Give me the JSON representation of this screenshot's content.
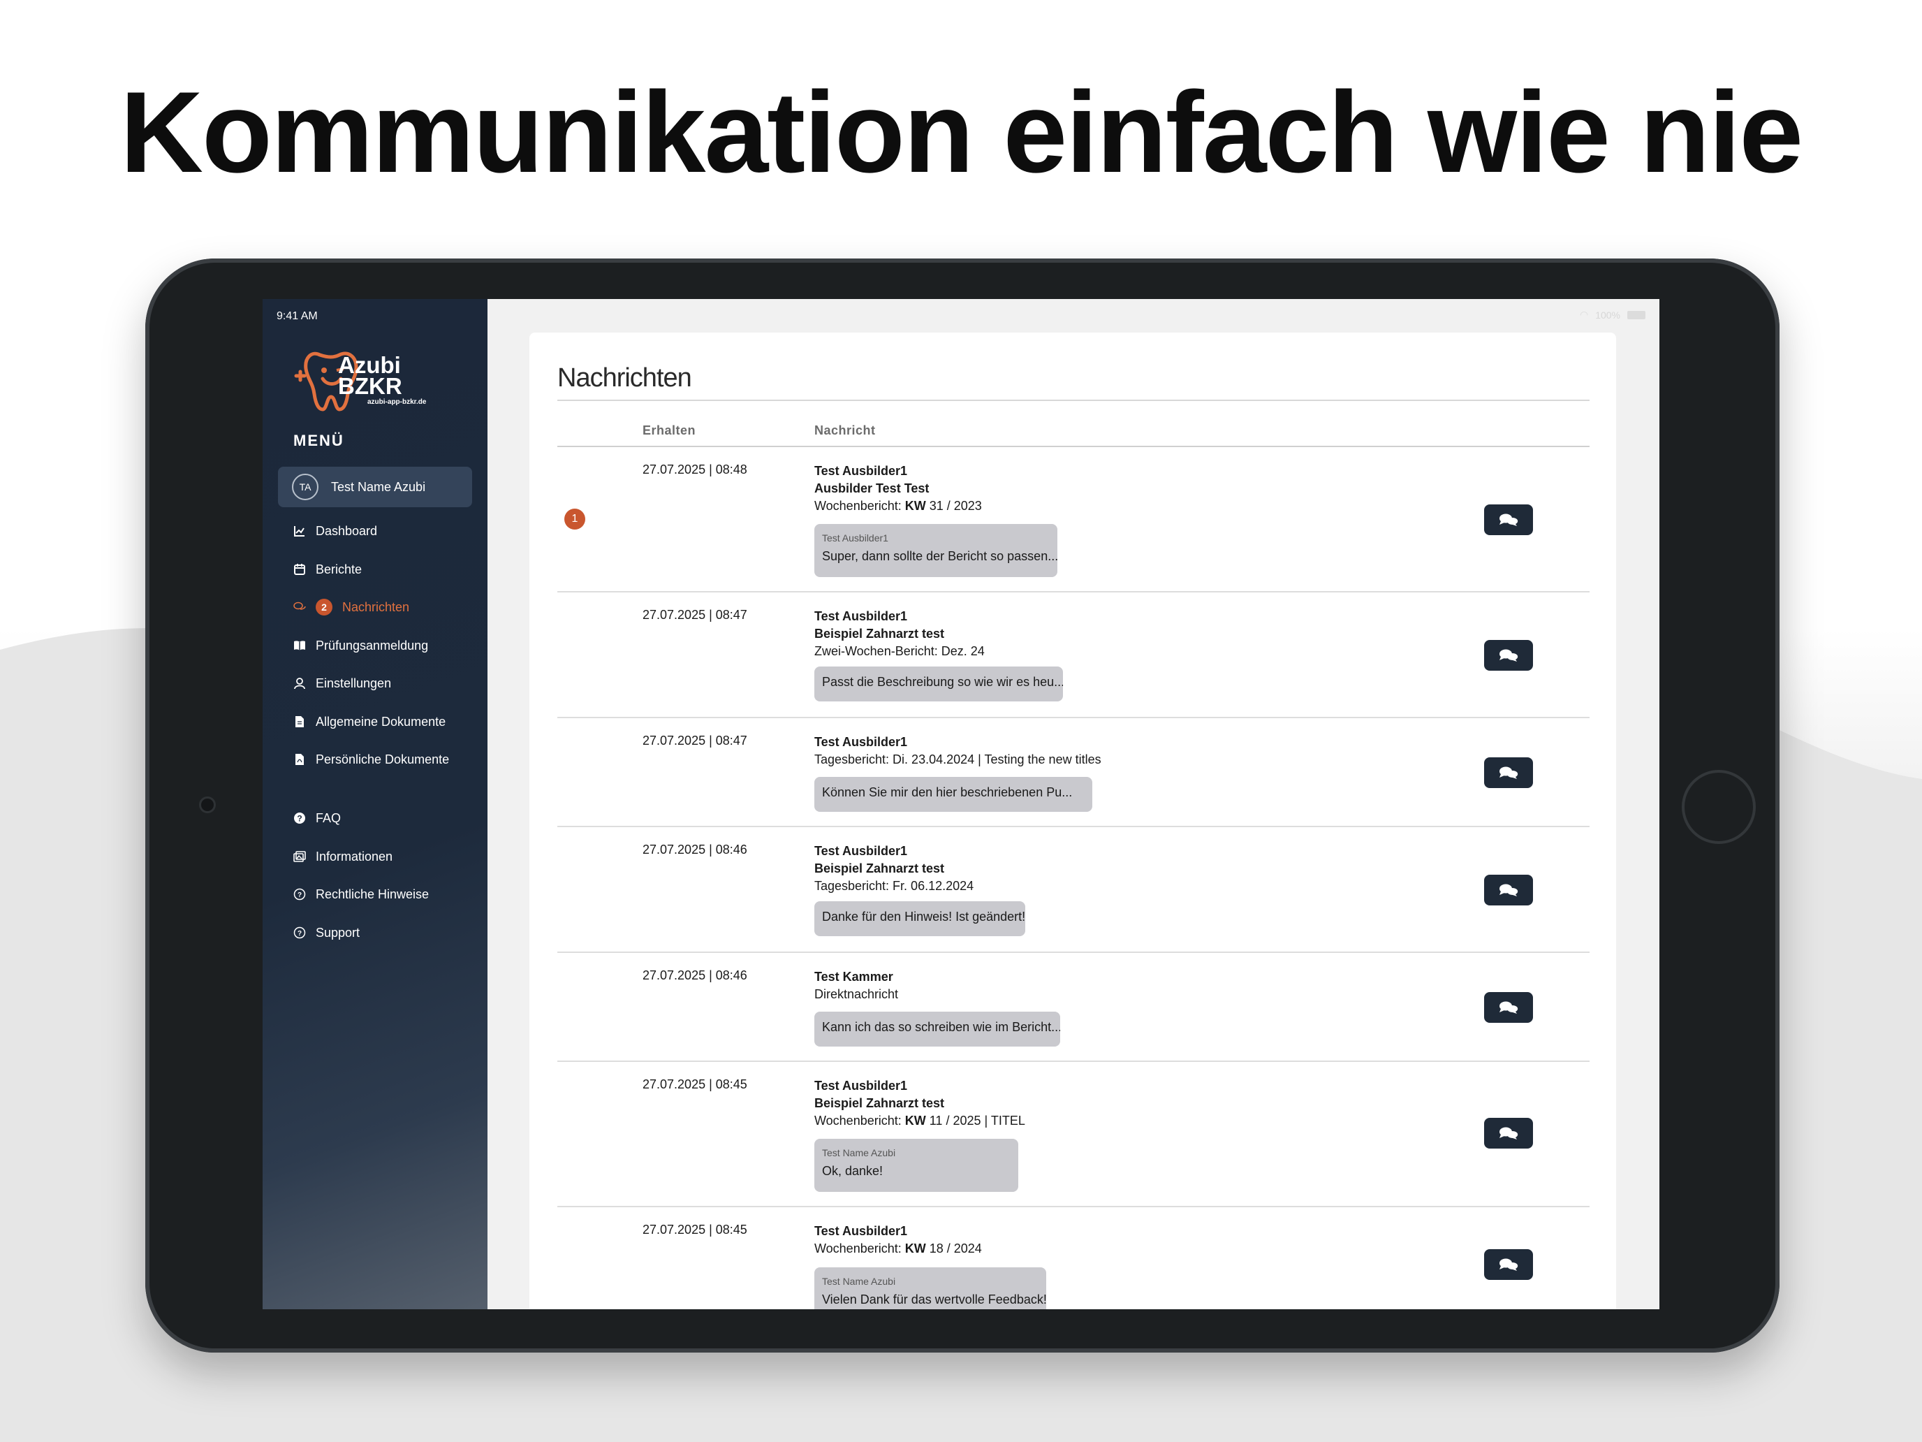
{
  "headline": "Kommunikation einfach wie nie",
  "status_bar": {
    "time": "9:41 AM",
    "battery": "100%"
  },
  "sidebar": {
    "logo": {
      "line1": "Azubi",
      "line2": "BZKR",
      "url": "azubi-app-bzkr.de"
    },
    "menu_title": "MENÜ",
    "user": {
      "initials": "TA",
      "name": "Test Name Azubi"
    },
    "items": [
      {
        "label": "Dashboard",
        "icon": "chart-icon"
      },
      {
        "label": "Berichte",
        "icon": "calendar-icon"
      },
      {
        "label": "Nachrichten",
        "icon": "chat-icon",
        "badge": "2",
        "active": true
      },
      {
        "label": "Prüfungsanmeldung",
        "icon": "book-icon"
      },
      {
        "label": "Einstellungen",
        "icon": "user-icon"
      },
      {
        "label": "Allgemeine Dokumente",
        "icon": "file-icon"
      },
      {
        "label": "Persönliche Dokumente",
        "icon": "pdf-file-icon"
      },
      {
        "label": "FAQ",
        "icon": "question-icon"
      },
      {
        "label": "Informationen",
        "icon": "images-icon"
      },
      {
        "label": "Rechtliche Hinweise",
        "icon": "question-circle-icon"
      },
      {
        "label": "Support",
        "icon": "question-circle-icon"
      }
    ]
  },
  "main": {
    "title": "Nachrichten",
    "columns": {
      "received": "Erhalten",
      "message": "Nachricht"
    },
    "messages": [
      {
        "unread": "1",
        "date": "27.07.2025 | 08:48",
        "sender": "Test Ausbilder1",
        "subtitle": "Ausbilder Test Test",
        "report_prefix": "Wochenbericht: ",
        "report_kw": "KW",
        "report_suffix": " 31 / 2023",
        "bubble_author": "Test Ausbilder1",
        "bubble_text": "Super, dann sollte der Bericht so passen..."
      },
      {
        "date": "27.07.2025 | 08:47",
        "sender": "Test Ausbilder1",
        "subtitle": "Beispiel Zahnarzt test",
        "report_prefix": "Zwei-Wochen-Bericht: Dez. 24",
        "bubble_text": "Passt die Beschreibung so wie wir es heu..."
      },
      {
        "date": "27.07.2025 | 08:47",
        "sender": "Test Ausbilder1",
        "report_prefix": "Tagesbericht: Di. 23.04.2024 | Testing the new titles",
        "bubble_text": "Können Sie mir den hier beschriebenen Pu..."
      },
      {
        "date": "27.07.2025 | 08:46",
        "sender": "Test Ausbilder1",
        "subtitle": "Beispiel Zahnarzt test",
        "report_prefix": "Tagesbericht: Fr. 06.12.2024",
        "bubble_text": "Danke für den Hinweis! Ist geändert!"
      },
      {
        "date": "27.07.2025 | 08:46",
        "sender": "Test Kammer",
        "report_prefix": "Direktnachricht",
        "bubble_text": "Kann ich das so schreiben wie im Bericht..."
      },
      {
        "date": "27.07.2025 | 08:45",
        "sender": "Test Ausbilder1",
        "subtitle": "Beispiel Zahnarzt test",
        "report_prefix": "Wochenbericht: ",
        "report_kw": "KW",
        "report_suffix": " 11 / 2025 | TITEL",
        "bubble_author": "Test Name Azubi",
        "bubble_text": "Ok, danke!"
      },
      {
        "date": "27.07.2025 | 08:45",
        "sender": "Test Ausbilder1",
        "report_prefix": "Wochenbericht: ",
        "report_kw": "KW",
        "report_suffix": " 18 / 2024",
        "bubble_author": "Test Name Azubi",
        "bubble_text": "Vielen Dank für das wertvolle Feedback!"
      }
    ]
  },
  "colors": {
    "accent": "#c9562e",
    "sidebar": "#1d2a3c",
    "button": "#1f2a38",
    "bubble": "#c9c9ce"
  }
}
